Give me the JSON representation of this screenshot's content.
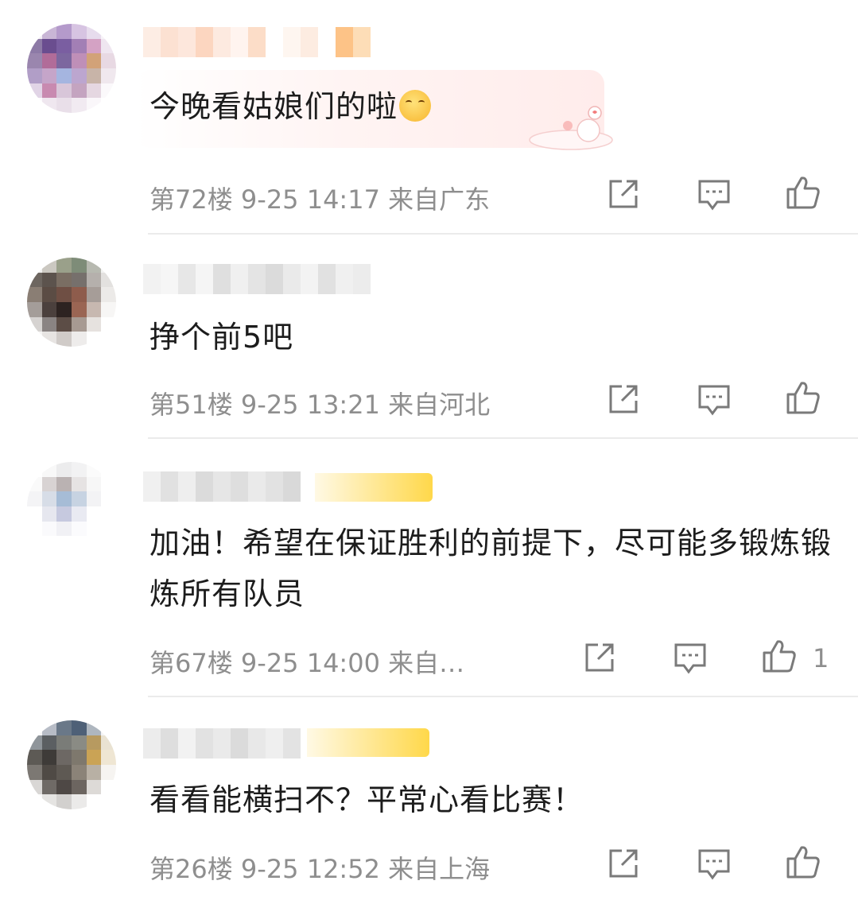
{
  "comments": [
    {
      "content": "今晚看姑娘们的啦",
      "floor": "第72楼",
      "time": "9-25 14:17",
      "location": "来自广东",
      "like_count": ""
    },
    {
      "content": "挣个前5吧",
      "floor": "第51楼",
      "time": "9-25 13:21",
      "location": "来自河北",
      "like_count": ""
    },
    {
      "content": "加油！希望在保证胜利的前提下，尽可能多锻炼锻炼所有队员",
      "floor": "第67楼",
      "time": "9-25 14:00",
      "location": "来自…",
      "like_count": "1"
    },
    {
      "content": "看看能横扫不？平常心看比赛！",
      "floor": "第26楼",
      "time": "9-25 12:52",
      "location": "来自上海",
      "like_count": ""
    }
  ],
  "icons": {
    "share": "share-icon",
    "reply": "comment-icon",
    "like": "thumbs-up-icon",
    "emoji": "shushing-face-emoji"
  },
  "colors": {
    "meta_text": "#8e8e8e",
    "content_text": "#1c1c1c",
    "divider": "#ebebeb",
    "vip_gold": "#ffd84a"
  }
}
